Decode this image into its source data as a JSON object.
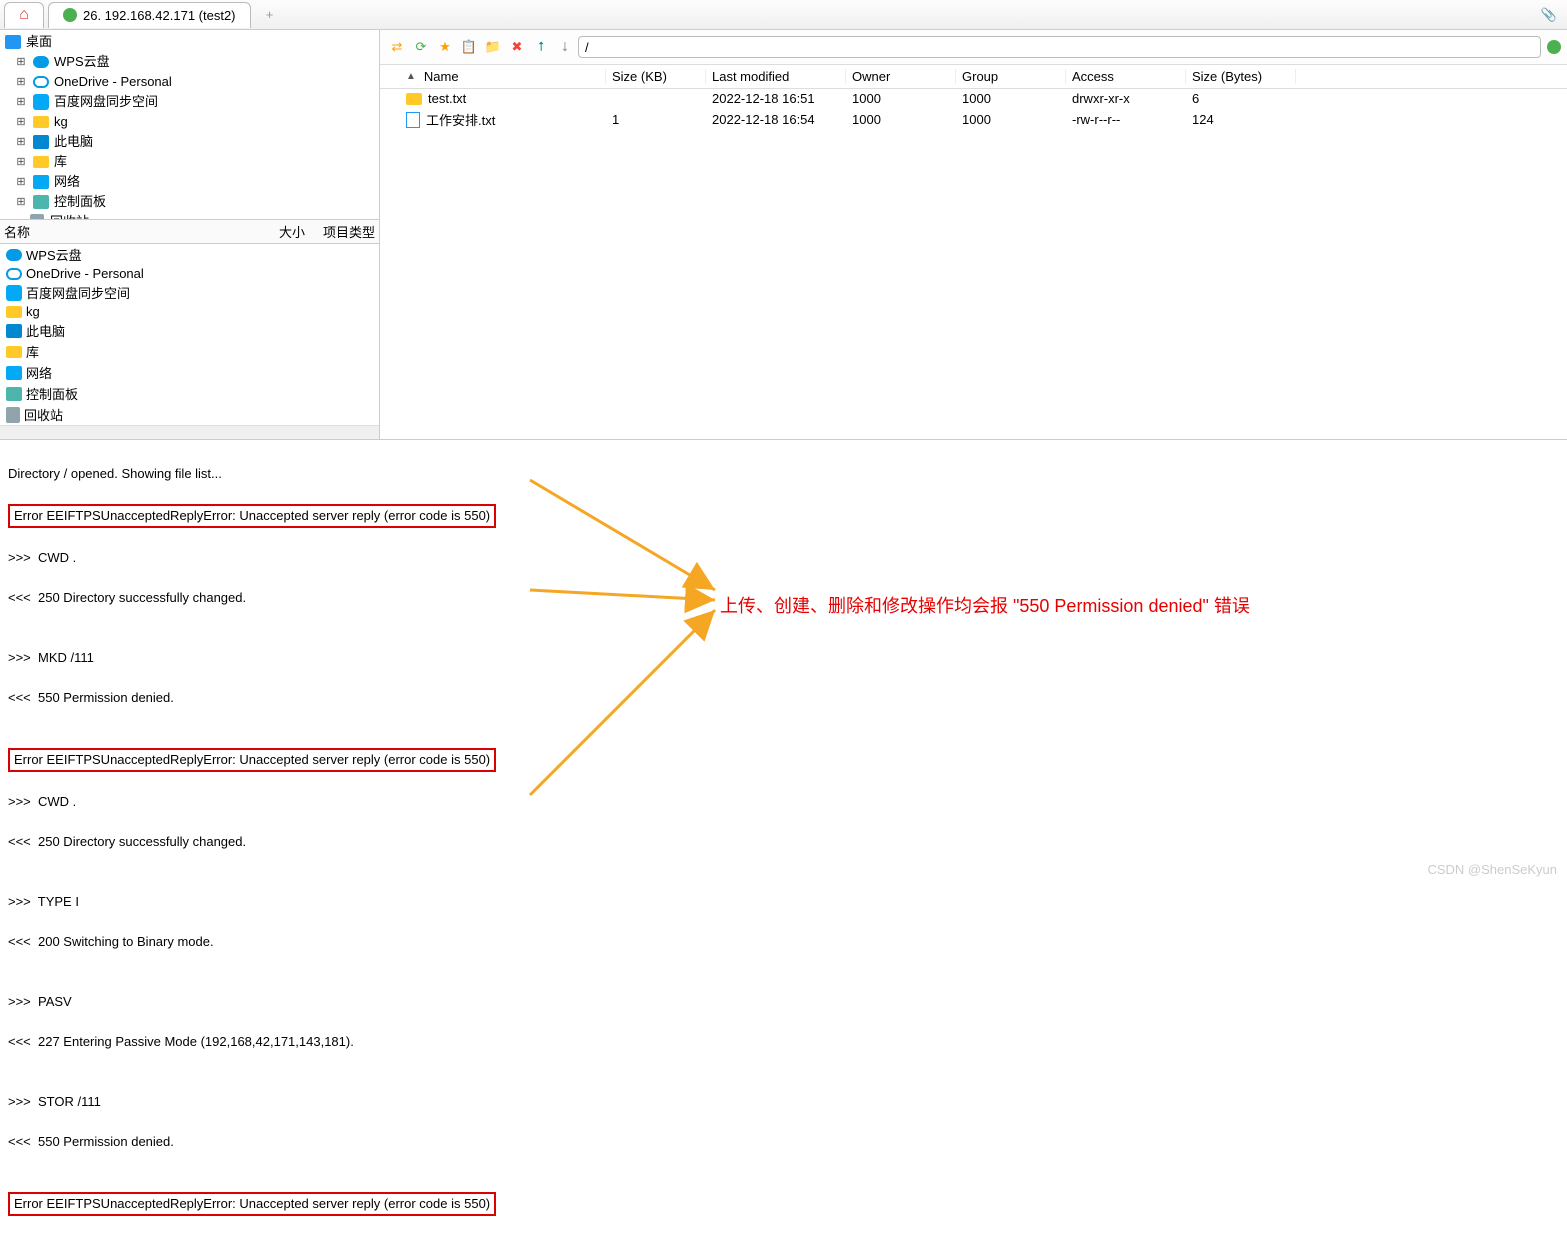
{
  "tabs": {
    "home_alt": "Home",
    "session": "26. 192.168.42.171 (test2)",
    "add": "+"
  },
  "tree": {
    "root": "桌面",
    "items": [
      {
        "label": "WPS云盘",
        "icon": "cloud-blue"
      },
      {
        "label": "OneDrive - Personal",
        "icon": "cloud-outline"
      },
      {
        "label": "百度网盘同步空间",
        "icon": "baidu"
      },
      {
        "label": "kg",
        "icon": "folder"
      },
      {
        "label": "此电脑",
        "icon": "pc"
      },
      {
        "label": "库",
        "icon": "folder"
      },
      {
        "label": "网络",
        "icon": "net"
      },
      {
        "label": "控制面板",
        "icon": "cpl"
      },
      {
        "label": "回收站",
        "icon": "trash"
      }
    ]
  },
  "local_cols": {
    "name": "名称",
    "size": "大小",
    "type": "项目类型"
  },
  "local_list": [
    {
      "label": "WPS云盘",
      "icon": "cloud-blue"
    },
    {
      "label": "OneDrive - Personal",
      "icon": "cloud-outline"
    },
    {
      "label": "百度网盘同步空间",
      "icon": "baidu"
    },
    {
      "label": "kg",
      "icon": "folder"
    },
    {
      "label": "此电脑",
      "icon": "pc"
    },
    {
      "label": "库",
      "icon": "folder"
    },
    {
      "label": "网络",
      "icon": "net"
    },
    {
      "label": "控制面板",
      "icon": "cpl"
    },
    {
      "label": "回收站",
      "icon": "trash"
    }
  ],
  "remote": {
    "path": "/",
    "cols": {
      "name": "Name",
      "size": "Size (KB)",
      "mod": "Last modified",
      "owner": "Owner",
      "group": "Group",
      "access": "Access",
      "bytes": "Size (Bytes)"
    },
    "rows": [
      {
        "name": "test.txt",
        "icon": "folder",
        "size": "",
        "mod": "2022-12-18 16:51",
        "owner": "1000",
        "group": "1000",
        "access": "drwxr-xr-x",
        "bytes": "6"
      },
      {
        "name": "工作安排.txt",
        "icon": "file",
        "size": "1",
        "mod": "2022-12-18 16:54",
        "owner": "1000",
        "group": "1000",
        "access": "-rw-r--r--",
        "bytes": "124"
      }
    ]
  },
  "log": {
    "l0": "Directory / opened. Showing file list...",
    "e1": "Error EEIFTPSUnacceptedReplyError: Unaccepted server reply (error code is 550)",
    "l1": ">>>  CWD .",
    "l2": "<<<  250 Directory successfully changed.",
    "l3": "",
    "l4": ">>>  MKD /111",
    "l5": "<<<  550 Permission denied.",
    "l6": "",
    "e2": "Error EEIFTPSUnacceptedReplyError: Unaccepted server reply (error code is 550)",
    "l7": ">>>  CWD .",
    "l8": "<<<  250 Directory successfully changed.",
    "l9": "",
    "l10": ">>>  TYPE I",
    "l11": "<<<  200 Switching to Binary mode.",
    "l12": "",
    "l13": ">>>  PASV",
    "l14": "<<<  227 Entering Passive Mode (192,168,42,171,143,181).",
    "l15": "",
    "l16": ">>>  STOR /111",
    "l17": "<<<  550 Permission denied.",
    "l18": "",
    "e3": "Error EEIFTPSUnacceptedReplyError: Unaccepted server reply (error code is 550)"
  },
  "annotation": "上传、创建、删除和修改操作均会报 \"550 Permission denied\" 错误",
  "watermark": "CSDN @ShenSeKyun"
}
